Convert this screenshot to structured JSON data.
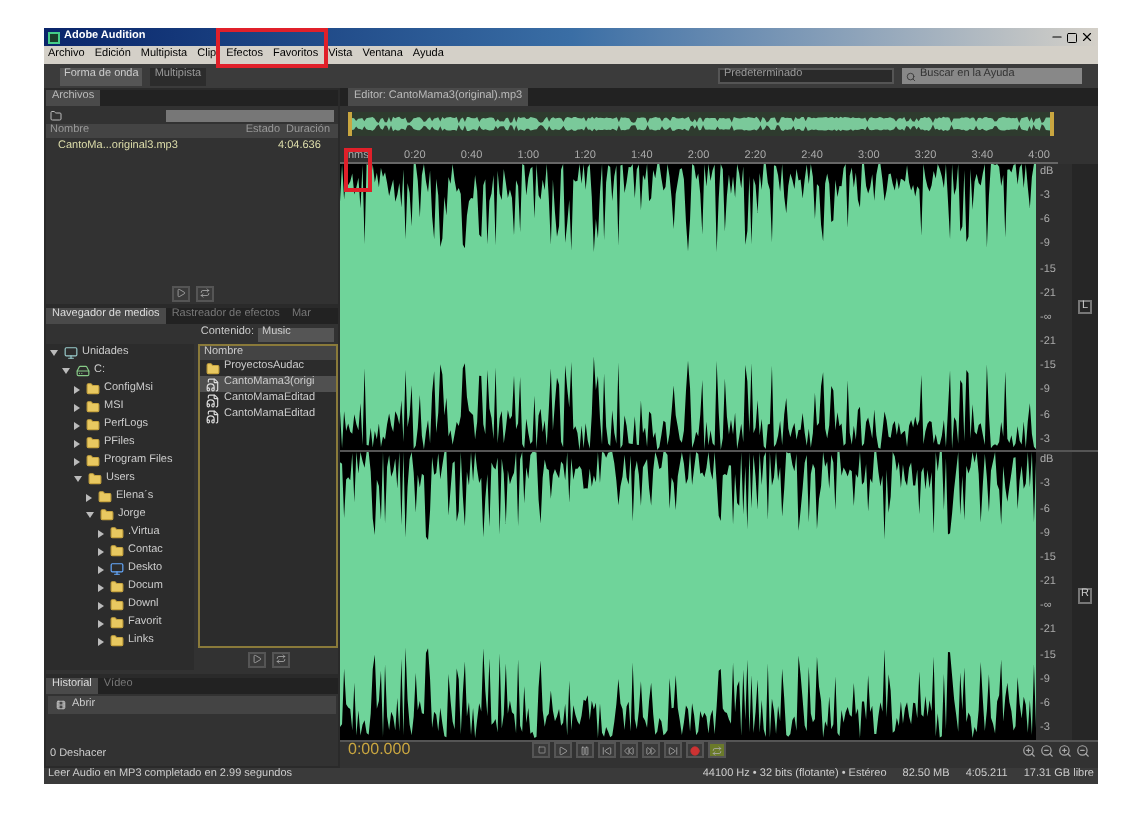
{
  "window": {
    "title": "Adobe Audition"
  },
  "menu": [
    "Archivo",
    "Edición",
    "Multipista",
    "Clip",
    "Efectos",
    "Favoritos",
    "Vista",
    "Ventana",
    "Ayuda"
  ],
  "toolbar": {
    "modes": [
      {
        "label": "Forma de onda",
        "selected": true
      },
      {
        "label": "Multipista",
        "selected": false
      }
    ],
    "workspace": "Predeterminado",
    "search": {
      "placeholder": "Buscar en la Ayuda"
    }
  },
  "files_panel": {
    "tab": "Archivos",
    "columns": [
      "Nombre",
      "Estado",
      "Duración"
    ],
    "rows": [
      {
        "name": "CantoMa...original3.mp3",
        "duration": "4:04.636"
      }
    ]
  },
  "media_panel": {
    "tabs": [
      {
        "label": "Navegador de medios",
        "selected": true
      },
      {
        "label": "Rastreador de efectos",
        "selected": false
      },
      {
        "label": "Mar",
        "selected": false
      }
    ],
    "contents_label": "Contenido:",
    "contents_value": "Music",
    "tree": [
      {
        "label": "Unidades",
        "kind": "computer",
        "expanded": true,
        "children": [
          {
            "label": "C:",
            "kind": "drive",
            "expanded": true,
            "children": [
              {
                "label": "ConfigMsi",
                "kind": "folder",
                "expanded": false
              },
              {
                "label": "MSI",
                "kind": "folder",
                "expanded": false
              },
              {
                "label": "PerfLogs",
                "kind": "folder",
                "expanded": false
              },
              {
                "label": "PFiles",
                "kind": "folder",
                "expanded": false
              },
              {
                "label": "Program Files",
                "kind": "folder",
                "expanded": false
              },
              {
                "label": "Users",
                "kind": "folder",
                "expanded": true,
                "children": [
                  {
                    "label": "Elena´s",
                    "kind": "folder",
                    "expanded": false
                  },
                  {
                    "label": "Jorge",
                    "kind": "folder",
                    "expanded": true,
                    "children": [
                      {
                        "label": ".Virtua",
                        "kind": "folder",
                        "expanded": false
                      },
                      {
                        "label": "Contac",
                        "kind": "folder",
                        "expanded": false
                      },
                      {
                        "label": "Deskto",
                        "kind": "desktop",
                        "expanded": false
                      },
                      {
                        "label": "Docum",
                        "kind": "folder",
                        "expanded": false
                      },
                      {
                        "label": "Downl",
                        "kind": "folder",
                        "expanded": false
                      },
                      {
                        "label": "Favorit",
                        "kind": "folder",
                        "expanded": false
                      },
                      {
                        "label": "Links",
                        "kind": "folder",
                        "expanded": false
                      }
                    ]
                  }
                ]
              }
            ]
          }
        ]
      }
    ],
    "list_column": "Nombre",
    "list": [
      {
        "label": "ProyectosAudac",
        "kind": "folder",
        "selected": false
      },
      {
        "label": "CantoMama3(origi",
        "kind": "file",
        "selected": true
      },
      {
        "label": "CantoMamaEditad",
        "kind": "file",
        "selected": false
      },
      {
        "label": "CantoMamaEditad",
        "kind": "file",
        "selected": false
      }
    ]
  },
  "history_panel": {
    "tabs": [
      {
        "label": "Historial",
        "selected": true
      },
      {
        "label": "Vídeo",
        "selected": false
      }
    ],
    "items": [
      "Abrir"
    ],
    "undo": "0 Deshacer"
  },
  "editor": {
    "tab": "Editor: CantoMama3(original).mp3",
    "ruler": [
      "hms",
      "0:20",
      "0:40",
      "1:00",
      "1:20",
      "1:40",
      "2:00",
      "2:20",
      "2:40",
      "3:00",
      "3:20",
      "3:40",
      "4:00"
    ],
    "channels": [
      {
        "label": "L",
        "scale": [
          "dB",
          "-3",
          "-6",
          "-9",
          "-15",
          "-21",
          "-∞",
          "-21",
          "-15",
          "-9",
          "-6",
          "-3"
        ]
      },
      {
        "label": "R",
        "scale": [
          "dB",
          "-3",
          "-6",
          "-9",
          "-15",
          "-21",
          "-∞",
          "-21",
          "-15",
          "-9",
          "-6",
          "-3"
        ]
      }
    ],
    "time": "0:00.000"
  },
  "status_bar": {
    "message": "Leer Audio en MP3 completado en 2.99 segundos",
    "format": "44100 Hz • 32 bits (flotante) • Estéreo",
    "size": "82.50 MB",
    "duration": "4:05.211",
    "free": "17.31 GB libre"
  }
}
